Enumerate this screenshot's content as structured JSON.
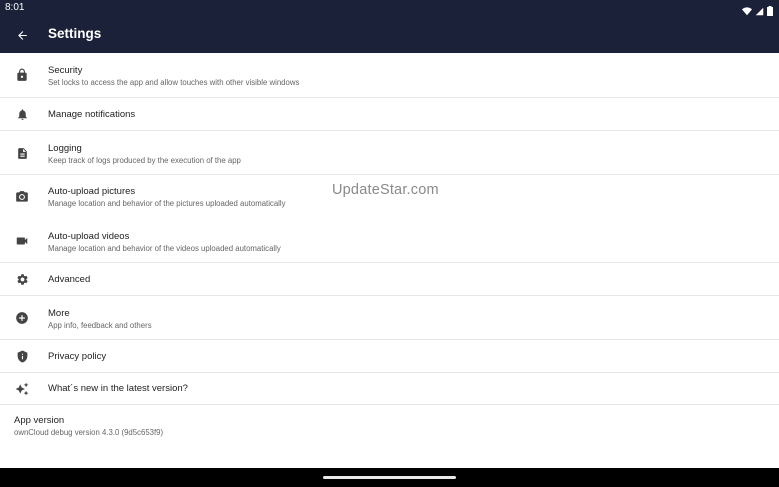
{
  "status_bar": {
    "time": "8:01",
    "icons": [
      "wifi-icon",
      "signal-icon",
      "battery-icon"
    ]
  },
  "app_bar": {
    "title": "Settings",
    "background": "#1b2138"
  },
  "settings": [
    {
      "icon": "lock-icon",
      "title": "Security",
      "subtitle": "Set locks to access the app and allow touches with other visible windows"
    },
    {
      "icon": "bell-icon",
      "title": "Manage notifications",
      "subtitle": ""
    },
    {
      "icon": "document-icon",
      "title": "Logging",
      "subtitle": "Keep track of logs produced by the execution of the app"
    },
    {
      "icon": "camera-icon",
      "title": "Auto-upload pictures",
      "subtitle": "Manage location and behavior of the pictures uploaded automatically"
    },
    {
      "icon": "video-icon",
      "title": "Auto-upload videos",
      "subtitle": "Manage location and behavior of the videos uploaded automatically"
    },
    {
      "icon": "gear-icon",
      "title": "Advanced",
      "subtitle": ""
    },
    {
      "icon": "plus-circle-icon",
      "title": "More",
      "subtitle": "App info, feedback and others"
    },
    {
      "icon": "shield-icon",
      "title": "Privacy policy",
      "subtitle": ""
    },
    {
      "icon": "sparkle-icon",
      "title": "What´s new in the latest version?",
      "subtitle": ""
    }
  ],
  "app_version": {
    "title": "App version",
    "value": "ownCloud debug version 4.3.0 (9d5c653f9)"
  },
  "watermark": "UpdateStar.com"
}
